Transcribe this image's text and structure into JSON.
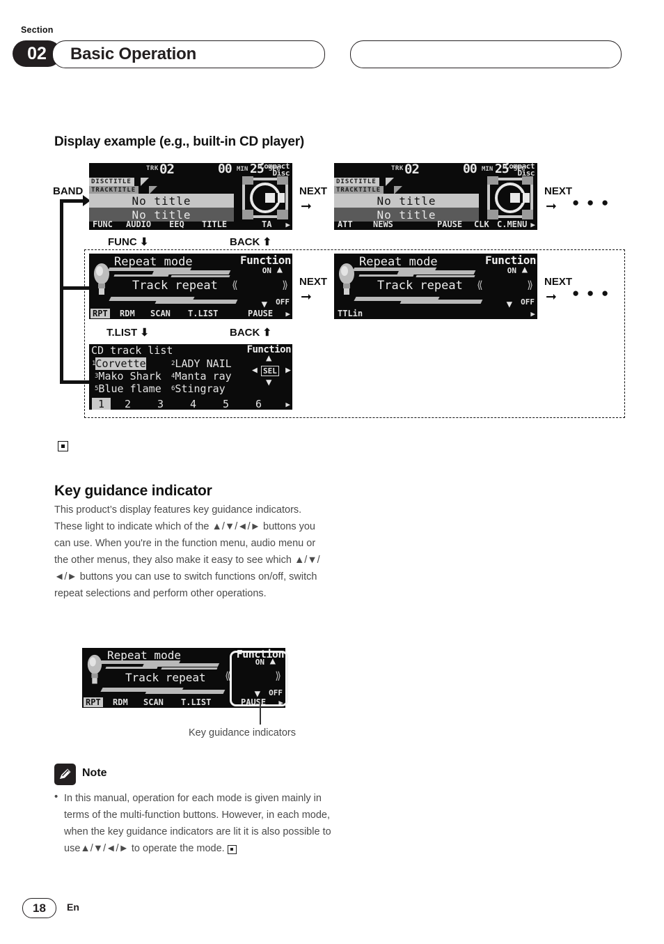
{
  "header": {
    "section_label": "Section",
    "section_number": "02",
    "title": "Basic Operation"
  },
  "display_example": {
    "heading": "Display example (e.g., built-in CD player)",
    "flow_labels": {
      "band": "BAND",
      "next": "NEXT",
      "func": "FUNC",
      "back": "BACK",
      "tlist": "T.LIST",
      "dots": "● ● ●"
    },
    "screen_play_1": {
      "trk_label": "TRK",
      "trk_number": "02",
      "time_min": "00",
      "min_unit": "MIN",
      "time_sec": "25",
      "sec_unit": "SEC",
      "logo_line1": "Compact",
      "logo_line2": "Disc",
      "tag_disc": "DISCTITLE",
      "tag_track": "TRACKTITLE",
      "disc_title": "No title",
      "track_title": "No title",
      "soft_keys": [
        "FUNC",
        "AUDIO",
        "EEQ",
        "TITLE",
        "TA"
      ]
    },
    "screen_play_2": {
      "trk_label": "TRK",
      "trk_number": "02",
      "time_min": "00",
      "min_unit": "MIN",
      "time_sec": "25",
      "sec_unit": "SEC",
      "logo_line1": "Compact",
      "logo_line2": "Disc",
      "tag_disc": "DISCTITLE",
      "tag_track": "TRACKTITLE",
      "disc_title": "No title",
      "track_title": "No title",
      "soft_keys": [
        "ATT",
        "NEWS",
        "PAUSE",
        "CLK",
        "C.MENU"
      ]
    },
    "screen_function_1": {
      "function_label": "Function",
      "mode_title": "Repeat mode",
      "mode_value": "Track repeat",
      "key_on": "ON",
      "key_off": "OFF",
      "soft_keys": [
        "RPT",
        "RDM",
        "SCAN",
        "T.LIST",
        "PAUSE"
      ],
      "highlighted_key": "RPT"
    },
    "screen_function_2": {
      "function_label": "Function",
      "mode_title": "Repeat mode",
      "mode_value": "Track repeat",
      "key_on": "ON",
      "key_off": "OFF",
      "soft_keys": [
        "TTLin"
      ]
    },
    "screen_tracklist": {
      "title": "CD track list",
      "function_label": "Function",
      "sel_label": "SEL",
      "tracks": [
        {
          "num": "1",
          "name": "Corvette",
          "selected": true
        },
        {
          "num": "2",
          "name": "LADY NAIL",
          "selected": false
        },
        {
          "num": "3",
          "name": "Mako Shark",
          "selected": false
        },
        {
          "num": "4",
          "name": "Manta ray",
          "selected": false
        },
        {
          "num": "5",
          "name": "Blue flame",
          "selected": false
        },
        {
          "num": "6",
          "name": "Stingray",
          "selected": false
        }
      ],
      "page_numbers": [
        "1",
        "2",
        "3",
        "4",
        "5",
        "6"
      ],
      "selected_page": "1"
    }
  },
  "key_guidance": {
    "heading": "Key guidance indicator",
    "paragraph": "This product’s display features key guidance indicators. These light to indicate which of the ▲/▼/◄/► buttons you can use. When you're in the function menu, audio menu or the other menus, they also make it easy to see which ▲/▼/◄/► buttons you can use to switch functions on/off, switch repeat selections and perform other operations.",
    "callout": "Key guidance indicators",
    "screen": {
      "function_label": "Function",
      "mode_title": "Repeat mode",
      "mode_value": "Track repeat",
      "key_on": "ON",
      "key_off": "OFF",
      "soft_keys": [
        "RPT",
        "RDM",
        "SCAN",
        "T.LIST",
        "PAUSE"
      ],
      "highlighted_key": "RPT"
    }
  },
  "note": {
    "title": "Note",
    "body": "In this manual, operation for each mode is given mainly in terms of the multi-function buttons. However, in each mode, when the key guidance indicators are lit it is also possible to use▲/▼/◄/► to operate the mode."
  },
  "footer": {
    "page_number": "18",
    "language": "En"
  },
  "colors": {
    "ink": "#231f20",
    "lcd_bg": "#0b0b0b",
    "lcd_fg": "#e6e6e6",
    "highlight": "#c9c9c9",
    "body_text": "#4a4a4a"
  }
}
